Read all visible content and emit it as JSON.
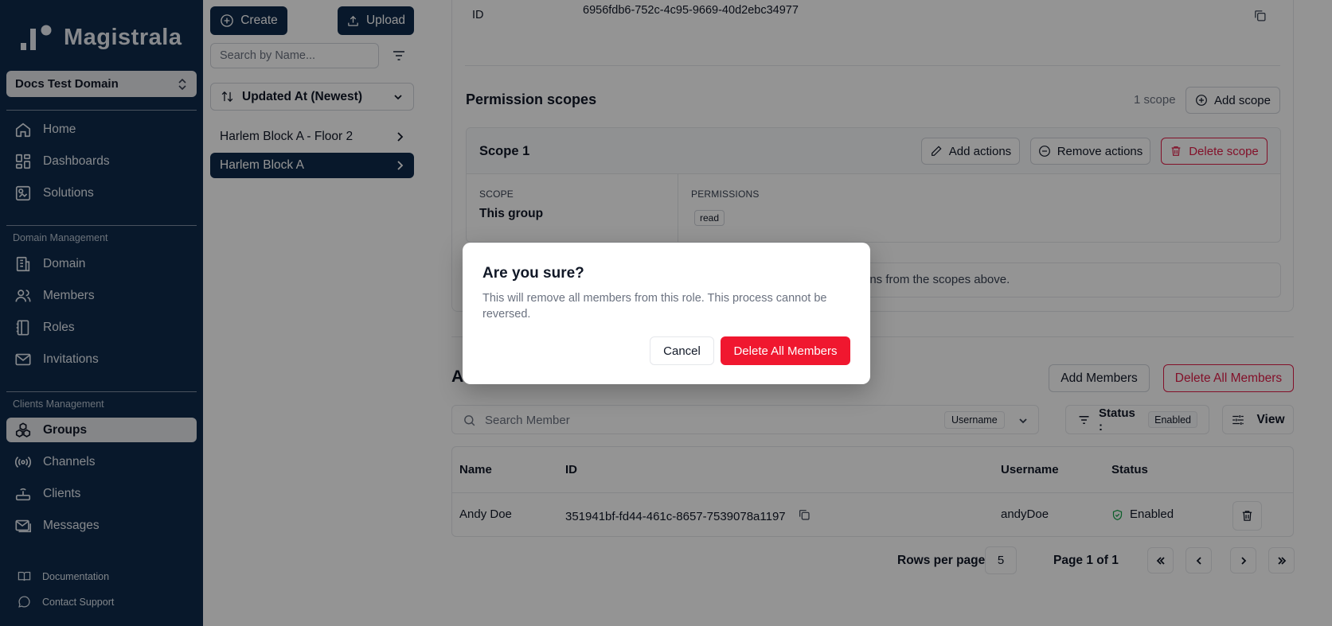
{
  "app": {
    "name": "Magistrala"
  },
  "sidebar": {
    "domain_selector": "Docs Test Domain",
    "main_items": [
      {
        "label": "Home",
        "icon": "home-icon"
      },
      {
        "label": "Dashboards",
        "icon": "dashboard-icon"
      },
      {
        "label": "Solutions",
        "icon": "solutions-icon"
      }
    ],
    "domain_section": {
      "label": "Domain Management",
      "items": [
        {
          "label": "Domain",
          "icon": "building-icon"
        },
        {
          "label": "Members",
          "icon": "users-icon"
        },
        {
          "label": "Roles",
          "icon": "notebook-icon"
        },
        {
          "label": "Invitations",
          "icon": "mail-icon"
        }
      ]
    },
    "clients_section": {
      "label": "Clients Management",
      "items": [
        {
          "label": "Groups",
          "icon": "groups-icon",
          "active": true
        },
        {
          "label": "Channels",
          "icon": "radio-icon"
        },
        {
          "label": "Clients",
          "icon": "router-icon"
        },
        {
          "label": "Messages",
          "icon": "messages-icon"
        }
      ]
    },
    "footer": [
      {
        "label": "Documentation",
        "icon": "book-icon"
      },
      {
        "label": "Contact Support",
        "icon": "chat-icon"
      }
    ]
  },
  "list_panel": {
    "create_label": "Create",
    "upload_label": "Upload",
    "search_placeholder": "Search by Name...",
    "sort_label": "Updated At (Newest)",
    "items": [
      {
        "label": "Harlem Block A - Floor 2",
        "active": false
      },
      {
        "label": "Harlem Block A",
        "active": true
      }
    ]
  },
  "role": {
    "id_label": "ID",
    "id_value": "6956fdb6-752c-4c95-9669-40d2ebc34977"
  },
  "permission_scopes": {
    "title": "Permission scopes",
    "count": "1 scope",
    "add_scope_label": "Add scope",
    "scope": {
      "name": "Scope 1",
      "add_actions_label": "Add actions",
      "remove_actions_label": "Remove actions",
      "delete_scope_label": "Delete scope",
      "scope_header": "SCOPE",
      "scope_value": "This group",
      "permissions_header": "PERMISSIONS",
      "permissions": [
        "read"
      ]
    },
    "info_text": "ons from the scopes above."
  },
  "members": {
    "title": "A",
    "add_members_label": "Add Members",
    "delete_all_label": "Delete All Members",
    "search_placeholder": "Search Member",
    "search_field": "Username",
    "status_label": "Status :",
    "status_value": "Enabled",
    "view_label": "View",
    "columns": [
      "Name",
      "ID",
      "Username",
      "Status"
    ],
    "rows": [
      {
        "name": "Andy Doe",
        "id": "351941bf-fd44-461c-8657-7539078a1197",
        "username": "andyDoe",
        "status": "Enabled"
      }
    ],
    "rows_per_page_label": "Rows per page",
    "rows_per_page": "5",
    "page_label": "Page 1 of 1"
  },
  "dialog": {
    "title": "Are you sure?",
    "description": "This will remove all members from this role. This process cannot be reversed.",
    "cancel_label": "Cancel",
    "confirm_label": "Delete All Members"
  },
  "colors": {
    "sidebar_bg": "#0f2a4a",
    "danger": "#f0172f",
    "success": "#16a34a"
  }
}
